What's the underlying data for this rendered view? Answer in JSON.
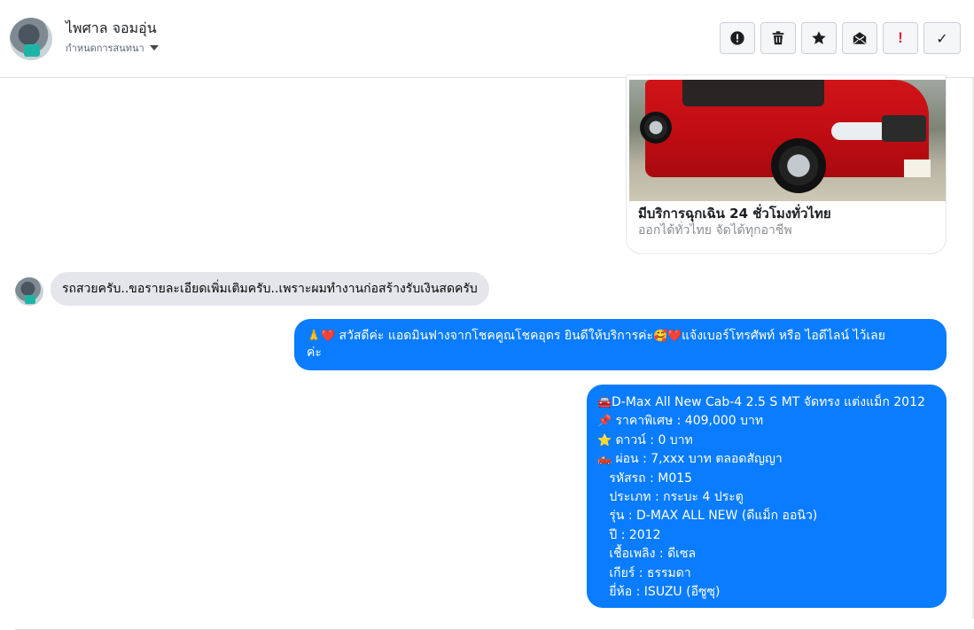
{
  "header": {
    "contact_name": "ไพศาล จอมอุ่น",
    "assign_label": "กำหนดการสนทนา",
    "toolbar": [
      {
        "name": "report-button",
        "icon": "alert-circle-icon"
      },
      {
        "name": "delete-button",
        "icon": "trash-icon"
      },
      {
        "name": "star-button",
        "icon": "star-icon"
      },
      {
        "name": "mark-unread-button",
        "icon": "envelope-icon"
      },
      {
        "name": "important-button",
        "icon": "exclamation-icon",
        "glyph": "!"
      },
      {
        "name": "done-button",
        "icon": "check-icon",
        "glyph": "✓"
      }
    ]
  },
  "link_card": {
    "title": "มีบริการฉุกเฉิน 24 ชั่วโมงทั่วไทย",
    "subtitle": "ออกได้ทั่วไทย จัดได้ทุกอาชีพ"
  },
  "messages": {
    "incoming": "รถสวยครับ..ขอรายละเอียดเพิ่มเติมครับ..เพราะผมทำงานก่อสร้างรับเงินสดครับ",
    "greeting": {
      "emoji1": "🙏",
      "emoji2": "❤️",
      "text1": " สวัสดีค่ะ แอดมินฟางจากโชคคูณโชคอุดร ยินดีให้บริการค่ะ",
      "emoji3": "🥰",
      "emoji4": "❤️",
      "text2": "แจ้งเบอร์โทรศัพท์ หรือ ไอดีไลน์  ไว้เลย",
      "text3": "ค่ะ"
    },
    "details": [
      {
        "emoji": "🚘",
        "text": "D-Max All New Cab-4 2.5 S MT จัดทรง แต่งแม็ก 2012"
      },
      {
        "emoji": "📌",
        "text": " ราคาพิเศษ : 409,000 บาท"
      },
      {
        "emoji": "⭐",
        "text": " ดาวน์ : 0 บาท"
      },
      {
        "emoji": "🛻",
        "text": " ผ่อน : 7,xxx บาท ตลอดสัญญา"
      },
      {
        "emoji": "",
        "text": "   รหัสรถ : M015"
      },
      {
        "emoji": "",
        "text": "   ประเภท : กระบะ 4 ประตู"
      },
      {
        "emoji": "",
        "text": "   รุ่น : D-MAX ALL NEW (ดีแม็ก ออนิว)"
      },
      {
        "emoji": "",
        "text": "   ปี : 2012"
      },
      {
        "emoji": "",
        "text": "   เชื้อเพลิง : ดีเซล"
      },
      {
        "emoji": "",
        "text": "   เกียร์ : ธรรมดา"
      },
      {
        "emoji": "",
        "text": "   ยี่ห้อ : ISUZU (อีซูซุ)"
      }
    ]
  },
  "colors": {
    "outgoing_bubble": "#0a7cff",
    "incoming_bubble": "#e4e6eb",
    "important_red": "#e41e3f"
  }
}
